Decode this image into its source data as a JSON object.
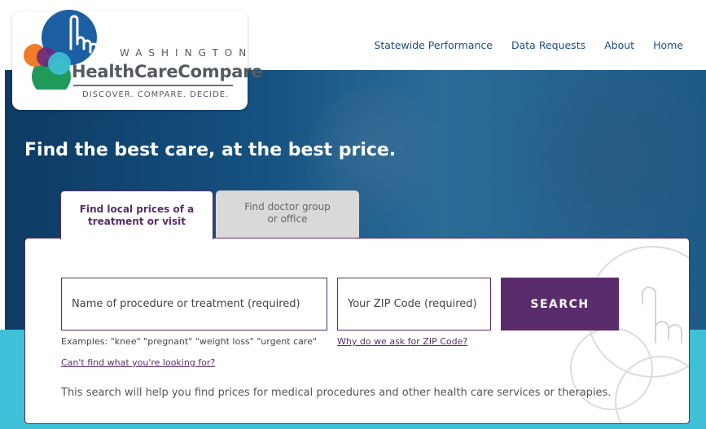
{
  "logo": {
    "state": "WASHINGTON",
    "name": "HealthCareCompare",
    "tagline": "DISCOVER. COMPARE. DECIDE.",
    "colors": {
      "blue": "#1d5fa3",
      "green": "#1f9a5a",
      "orange": "#f07c2a",
      "purple": "#6b2a7c",
      "teal": "#3ec1d6"
    }
  },
  "nav": {
    "items": [
      {
        "label": "Statewide Performance"
      },
      {
        "label": "Data Requests"
      },
      {
        "label": "About"
      },
      {
        "label": "Home"
      }
    ]
  },
  "hero": {
    "headline": "Find the best care, at the best price."
  },
  "tabs": [
    {
      "label_line1": "Find local prices of a",
      "label_line2": "treatment or visit",
      "active": true
    },
    {
      "label_line1": "Find doctor group",
      "label_line2": "or office",
      "active": false
    }
  ],
  "search": {
    "procedure_placeholder": "Name of procedure or treatment (required)",
    "zip_placeholder": "Your ZIP Code (required)",
    "button_label": "SEARCH",
    "examples": "Examples: \"knee\" \"pregnant\" \"weight loss\" \"urgent care\"",
    "zip_link": "Why do we ask for ZIP Code?",
    "help_link": "Can't find what you're looking for?",
    "note": "This search will help you find prices for medical procedures and other health care services or therapies."
  },
  "colors": {
    "nav_text": "#1d4f86",
    "accent_purple": "#5a2c6b",
    "hero_blue": "#15507f",
    "band_teal": "#3ec1d6"
  }
}
